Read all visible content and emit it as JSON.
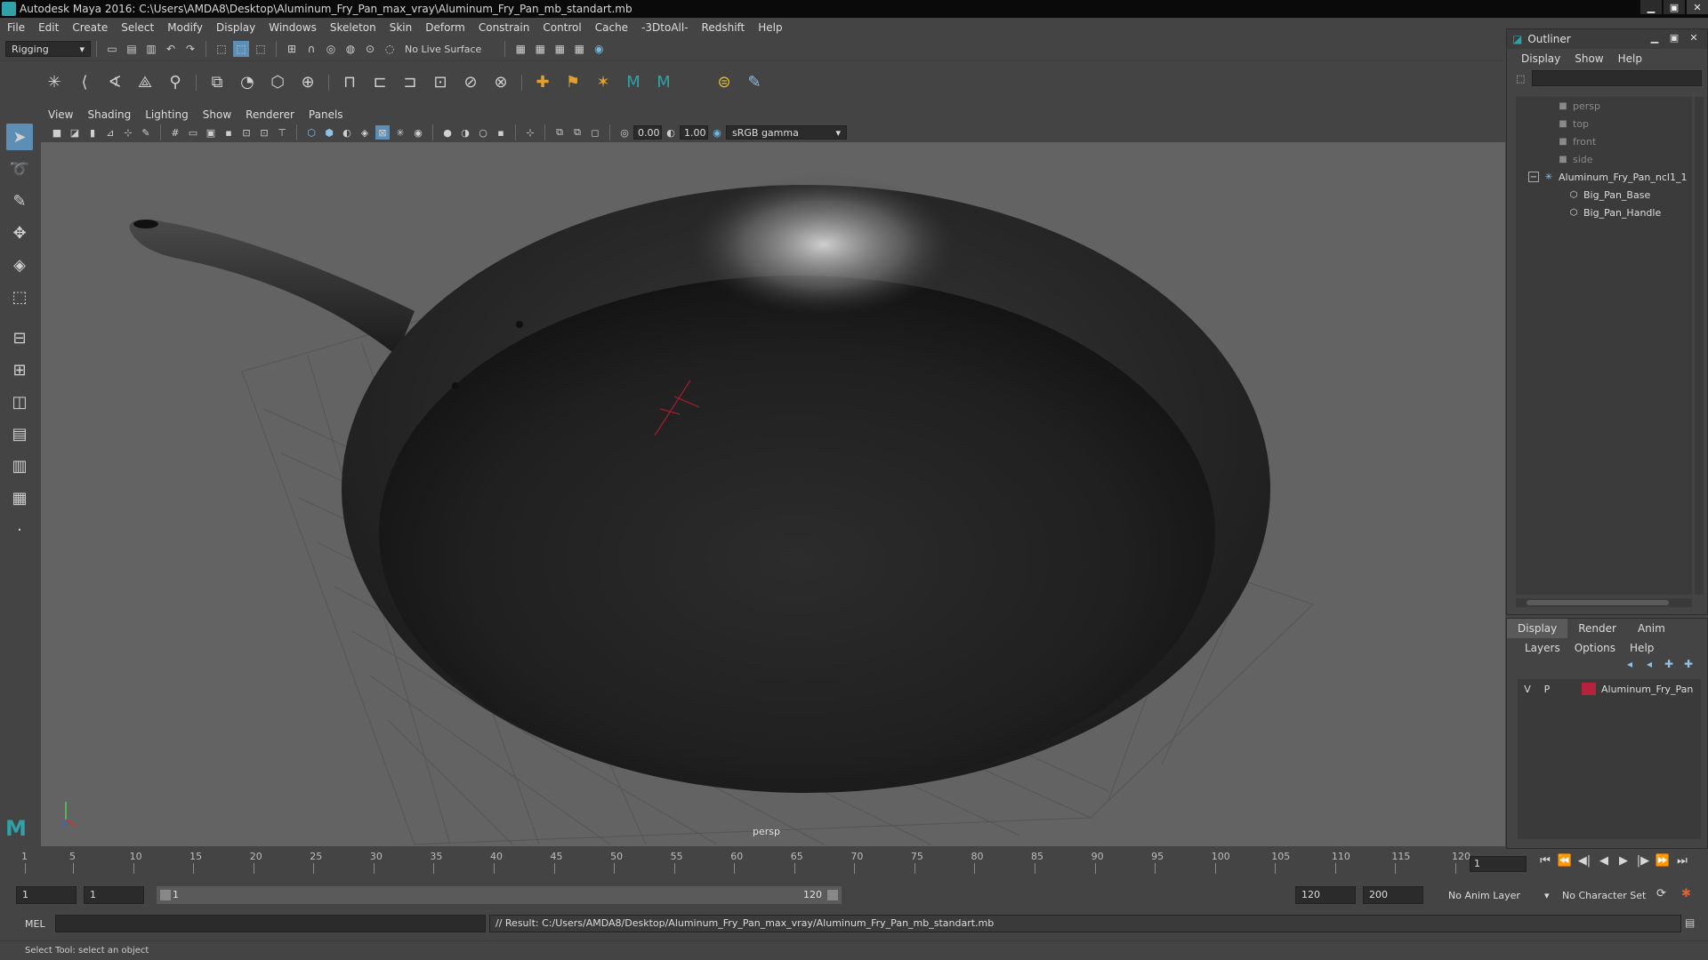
{
  "window": {
    "title": "Autodesk Maya 2016: C:\\Users\\AMDA8\\Desktop\\Aluminum_Fry_Pan_max_vray\\Aluminum_Fry_Pan_mb_standart.mb",
    "minimize": "▁",
    "restore": "▣",
    "close": "✕"
  },
  "menubar": [
    "File",
    "Edit",
    "Create",
    "Select",
    "Modify",
    "Display",
    "Windows",
    "Skeleton",
    "Skin",
    "Deform",
    "Constrain",
    "Control",
    "Cache",
    "-3DtoAll-",
    "Redshift",
    "Help"
  ],
  "statusline": {
    "menu_set": "Rigging",
    "live_surface": "No Live Surface"
  },
  "panel": {
    "menu": [
      "View",
      "Shading",
      "Lighting",
      "Show",
      "Renderer",
      "Panels"
    ],
    "exposure": "0.00",
    "gamma": "1.00",
    "color_space": "sRGB gamma",
    "camera_label": "persp"
  },
  "outliner": {
    "title": "Outliner",
    "menu": [
      "Display",
      "Show",
      "Help"
    ],
    "items": [
      {
        "label": "persp",
        "type": "camera",
        "dim": true,
        "indent": 1
      },
      {
        "label": "top",
        "type": "camera",
        "dim": true,
        "indent": 1
      },
      {
        "label": "front",
        "type": "camera",
        "dim": true,
        "indent": 1
      },
      {
        "label": "side",
        "type": "camera",
        "dim": true,
        "indent": 1
      },
      {
        "label": "Aluminum_Fry_Pan_ncl1_1",
        "type": "group",
        "dim": false,
        "indent": 0
      },
      {
        "label": "Big_Pan_Base",
        "type": "mesh",
        "dim": false,
        "indent": 2
      },
      {
        "label": "Big_Pan_Handle",
        "type": "mesh",
        "dim": false,
        "indent": 2
      }
    ]
  },
  "layer_editor": {
    "tabs": [
      "Display",
      "Render",
      "Anim"
    ],
    "active_tab": "Display",
    "menu": [
      "Layers",
      "Options",
      "Help"
    ],
    "layers": [
      {
        "v": "V",
        "p": "P",
        "name": "Aluminum_Fry_Pan",
        "color": "#b4233a"
      }
    ]
  },
  "timeslider": {
    "ticks": [
      "1",
      "5",
      "10",
      "15",
      "20",
      "25",
      "30",
      "35",
      "40",
      "45",
      "50",
      "55",
      "60",
      "65",
      "70",
      "75",
      "80",
      "85",
      "90",
      "95",
      "100",
      "105",
      "110",
      "115",
      "120"
    ],
    "current_frame": "1"
  },
  "rangeslider": {
    "start": "1",
    "playback_start": "1",
    "range_start_label": "1",
    "range_end_label": "120",
    "playback_end": "120",
    "end": "200",
    "anim_layer": "No Anim Layer",
    "character_set": "No Character Set"
  },
  "cmdline": {
    "label": "MEL",
    "result": "// Result: C:/Users/AMDA8/Desktop/Aluminum_Fry_Pan_max_vray/Aluminum_Fry_Pan_mb_standart.mb"
  },
  "helpline": "Select Tool: select an object",
  "icons": {
    "playback": [
      "⏮",
      "⏪",
      "◀|",
      "◀",
      "▶",
      "|▶",
      "⏩",
      "⏭"
    ]
  }
}
